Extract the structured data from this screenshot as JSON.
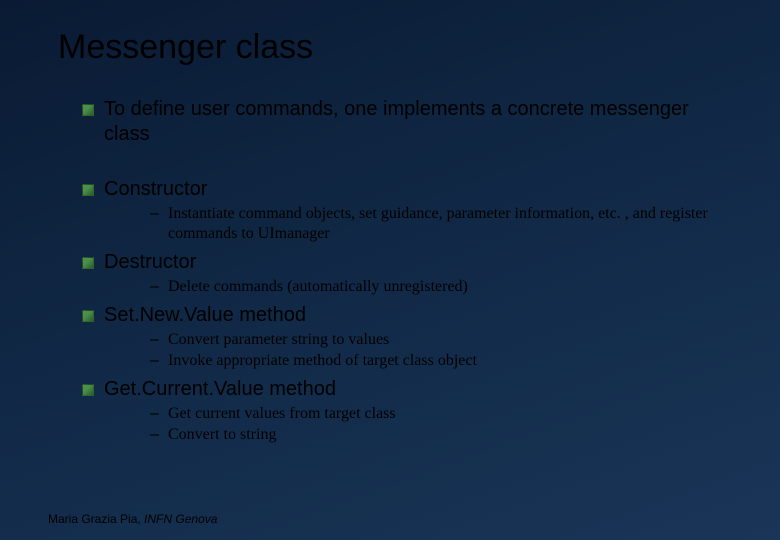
{
  "title": "Messenger class",
  "bullets": [
    {
      "text": "To define user commands, one implements a concrete messenger class",
      "gap": true,
      "sub": []
    },
    {
      "text": "Constructor",
      "gap": false,
      "sub": [
        "Instantiate command objects, set guidance, parameter information, etc. , and register commands to UImanager"
      ]
    },
    {
      "text": "Destructor",
      "gap": false,
      "sub": [
        "Delete commands (automatically unregistered)"
      ]
    },
    {
      "text": "Set.New.Value method",
      "gap": false,
      "sub": [
        "Convert parameter string to values",
        "Invoke appropriate method of target class object"
      ]
    },
    {
      "text": "Get.Current.Value method",
      "gap": false,
      "sub": [
        "Get current values from target class",
        "Convert to string"
      ]
    }
  ],
  "footer": {
    "author": "Maria Grazia Pia, ",
    "institution": "INFN Genova"
  }
}
